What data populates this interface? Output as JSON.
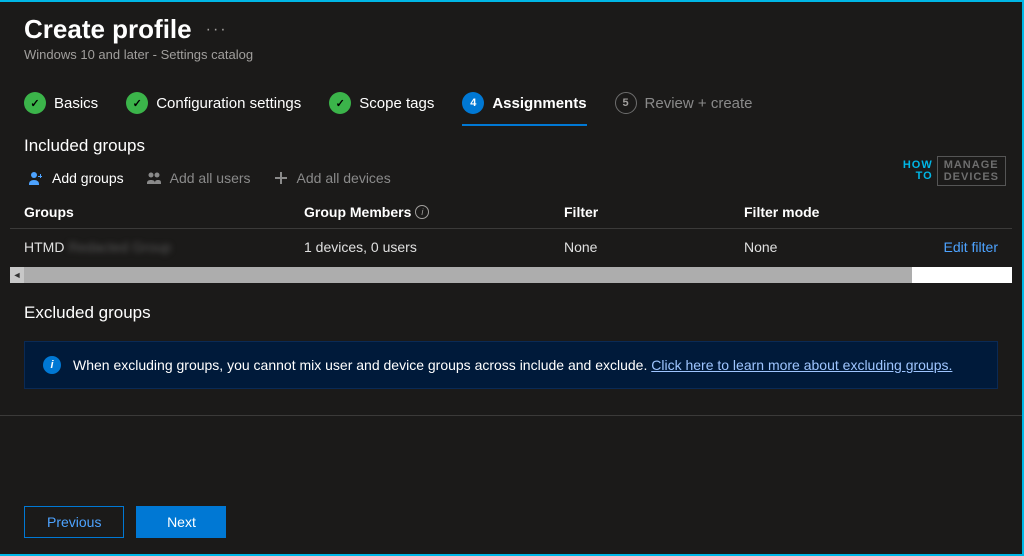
{
  "header": {
    "title": "Create profile",
    "subtitle": "Windows 10 and later - Settings catalog"
  },
  "wizard": {
    "steps": [
      {
        "label": "Basics",
        "status": "done"
      },
      {
        "label": "Configuration settings",
        "status": "done"
      },
      {
        "label": "Scope tags",
        "status": "done"
      },
      {
        "num": "4",
        "label": "Assignments",
        "status": "active"
      },
      {
        "num": "5",
        "label": "Review + create",
        "status": "todo"
      }
    ]
  },
  "sections": {
    "included_title": "Included groups",
    "excluded_title": "Excluded groups"
  },
  "toolbar": {
    "add_groups": "Add groups",
    "add_all_users": "Add all users",
    "add_all_devices": "Add all devices"
  },
  "table": {
    "columns": {
      "groups": "Groups",
      "members": "Group Members",
      "filter": "Filter",
      "mode": "Filter mode"
    },
    "rows": [
      {
        "name_prefix": "HTMD",
        "name_redacted": "Redacted Group",
        "members": "1 devices, 0 users",
        "filter": "None",
        "mode": "None",
        "action": "Edit filter"
      }
    ]
  },
  "banner": {
    "text": "When excluding groups, you cannot mix user and device groups across include and exclude. ",
    "link": "Click here to learn more about excluding groups."
  },
  "footer": {
    "previous": "Previous",
    "next": "Next"
  },
  "watermark": {
    "left_top": "HOW",
    "left_bottom": "TO",
    "right_top": "MANAGE",
    "right_bottom": "DEVICES"
  }
}
